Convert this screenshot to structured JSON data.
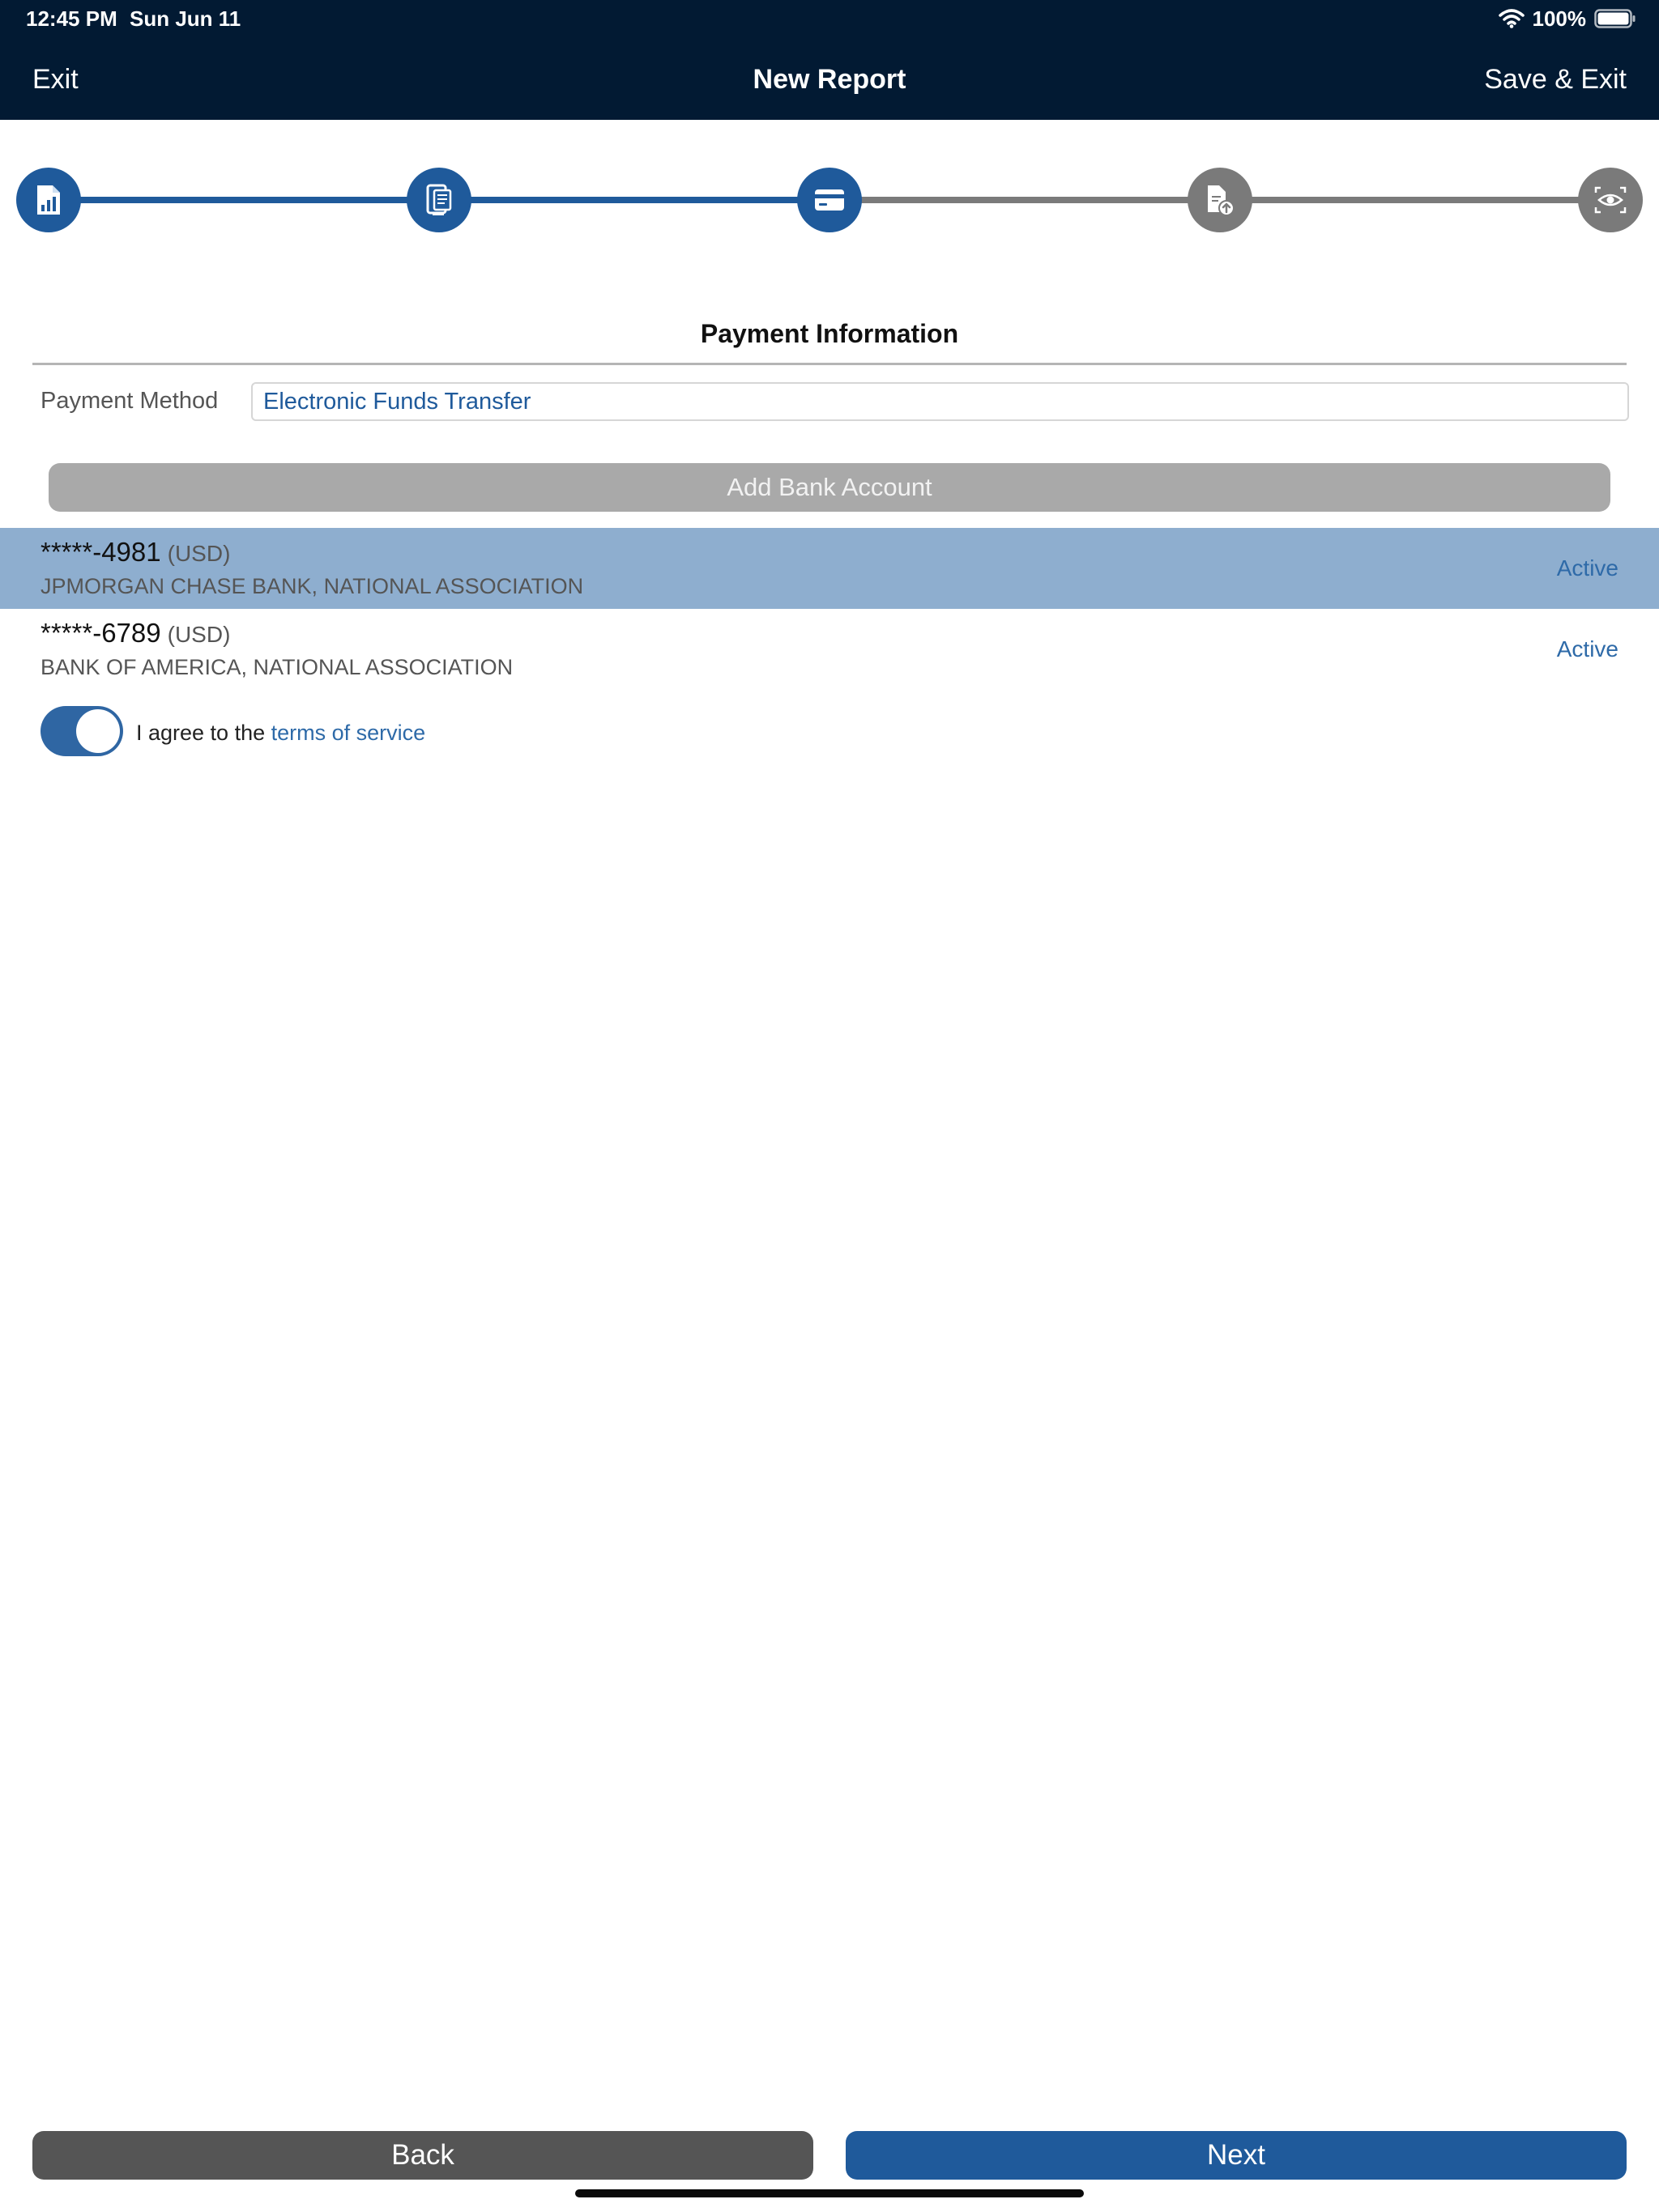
{
  "status_bar": {
    "time": "12:45 PM",
    "date": "Sun Jun 11",
    "battery": "100%",
    "icons": [
      "wifi-icon",
      "battery-icon"
    ]
  },
  "nav": {
    "exit_label": "Exit",
    "title": "New Report",
    "save_exit_label": "Save & Exit"
  },
  "stepper": {
    "current_step": 3,
    "steps": [
      {
        "icon": "report-chart-icon",
        "state": "done"
      },
      {
        "icon": "receipt-scan-icon",
        "state": "done"
      },
      {
        "icon": "credit-card-icon",
        "state": "current"
      },
      {
        "icon": "document-upload-icon",
        "state": "todo"
      },
      {
        "icon": "review-eye-icon",
        "state": "todo"
      }
    ]
  },
  "payment": {
    "section_title": "Payment Information",
    "method_label": "Payment Method",
    "method_value": "Electronic Funds Transfer",
    "add_bank_label": "Add Bank Account",
    "accounts": [
      {
        "number": "*****-4981",
        "currency": "(USD)",
        "bank": "JPMORGAN CHASE BANK, NATIONAL ASSOCIATION",
        "status": "Active",
        "selected": true
      },
      {
        "number": "*****-6789",
        "currency": "(USD)",
        "bank": "BANK OF AMERICA, NATIONAL ASSOCIATION",
        "status": "Active",
        "selected": false
      }
    ],
    "agree_prefix": "I agree to the",
    "terms_link": "terms of service",
    "agreed": true
  },
  "footer": {
    "back_label": "Back",
    "next_label": "Next"
  },
  "colors": {
    "header_bg": "#021a33",
    "primary": "#1f5a9b",
    "step_inactive": "#7a7a7a",
    "selected_row": "#8eaecf",
    "link": "#2e6aa8",
    "disabled_button": "#a9a9a9",
    "back_button": "#555555"
  }
}
